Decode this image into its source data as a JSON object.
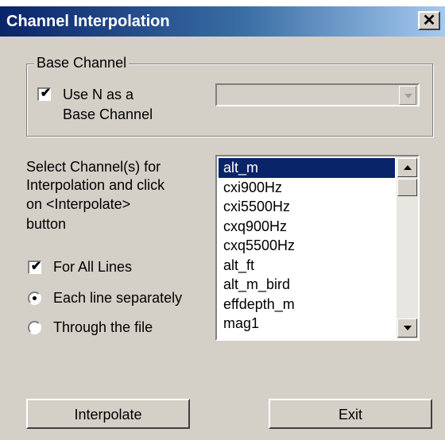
{
  "window": {
    "title": "Channel Interpolation",
    "close_label": "✕"
  },
  "base_channel": {
    "group_label": "Base Channel",
    "checkbox_line1": "Use N as a",
    "checkbox_line2": "Base Channel",
    "checked": true,
    "combo_value": ""
  },
  "instructions": {
    "line1": "Select Channel(s) for",
    "line2": "Interpolation and click",
    "line3": "on <Interpolate>",
    "line4": "button"
  },
  "channels": {
    "items": [
      "alt_m",
      "cxi900Hz",
      "cxi5500Hz",
      "cxq900Hz",
      "cxq5500Hz",
      "alt_ft",
      "alt_m_bird",
      "effdepth_m",
      "mag1"
    ],
    "selected_index": 0
  },
  "options": {
    "for_all_lines_label": "For All Lines",
    "for_all_lines_checked": true,
    "radio_each_label": "Each line separately",
    "radio_through_label": "Through the file",
    "radio_selected": "each"
  },
  "buttons": {
    "interpolate": "Interpolate",
    "exit": "Exit"
  },
  "colors": {
    "title_start": "#0a246a",
    "title_end": "#a6caf0",
    "face": "#d4d0c8",
    "selection": "#0a246a"
  }
}
